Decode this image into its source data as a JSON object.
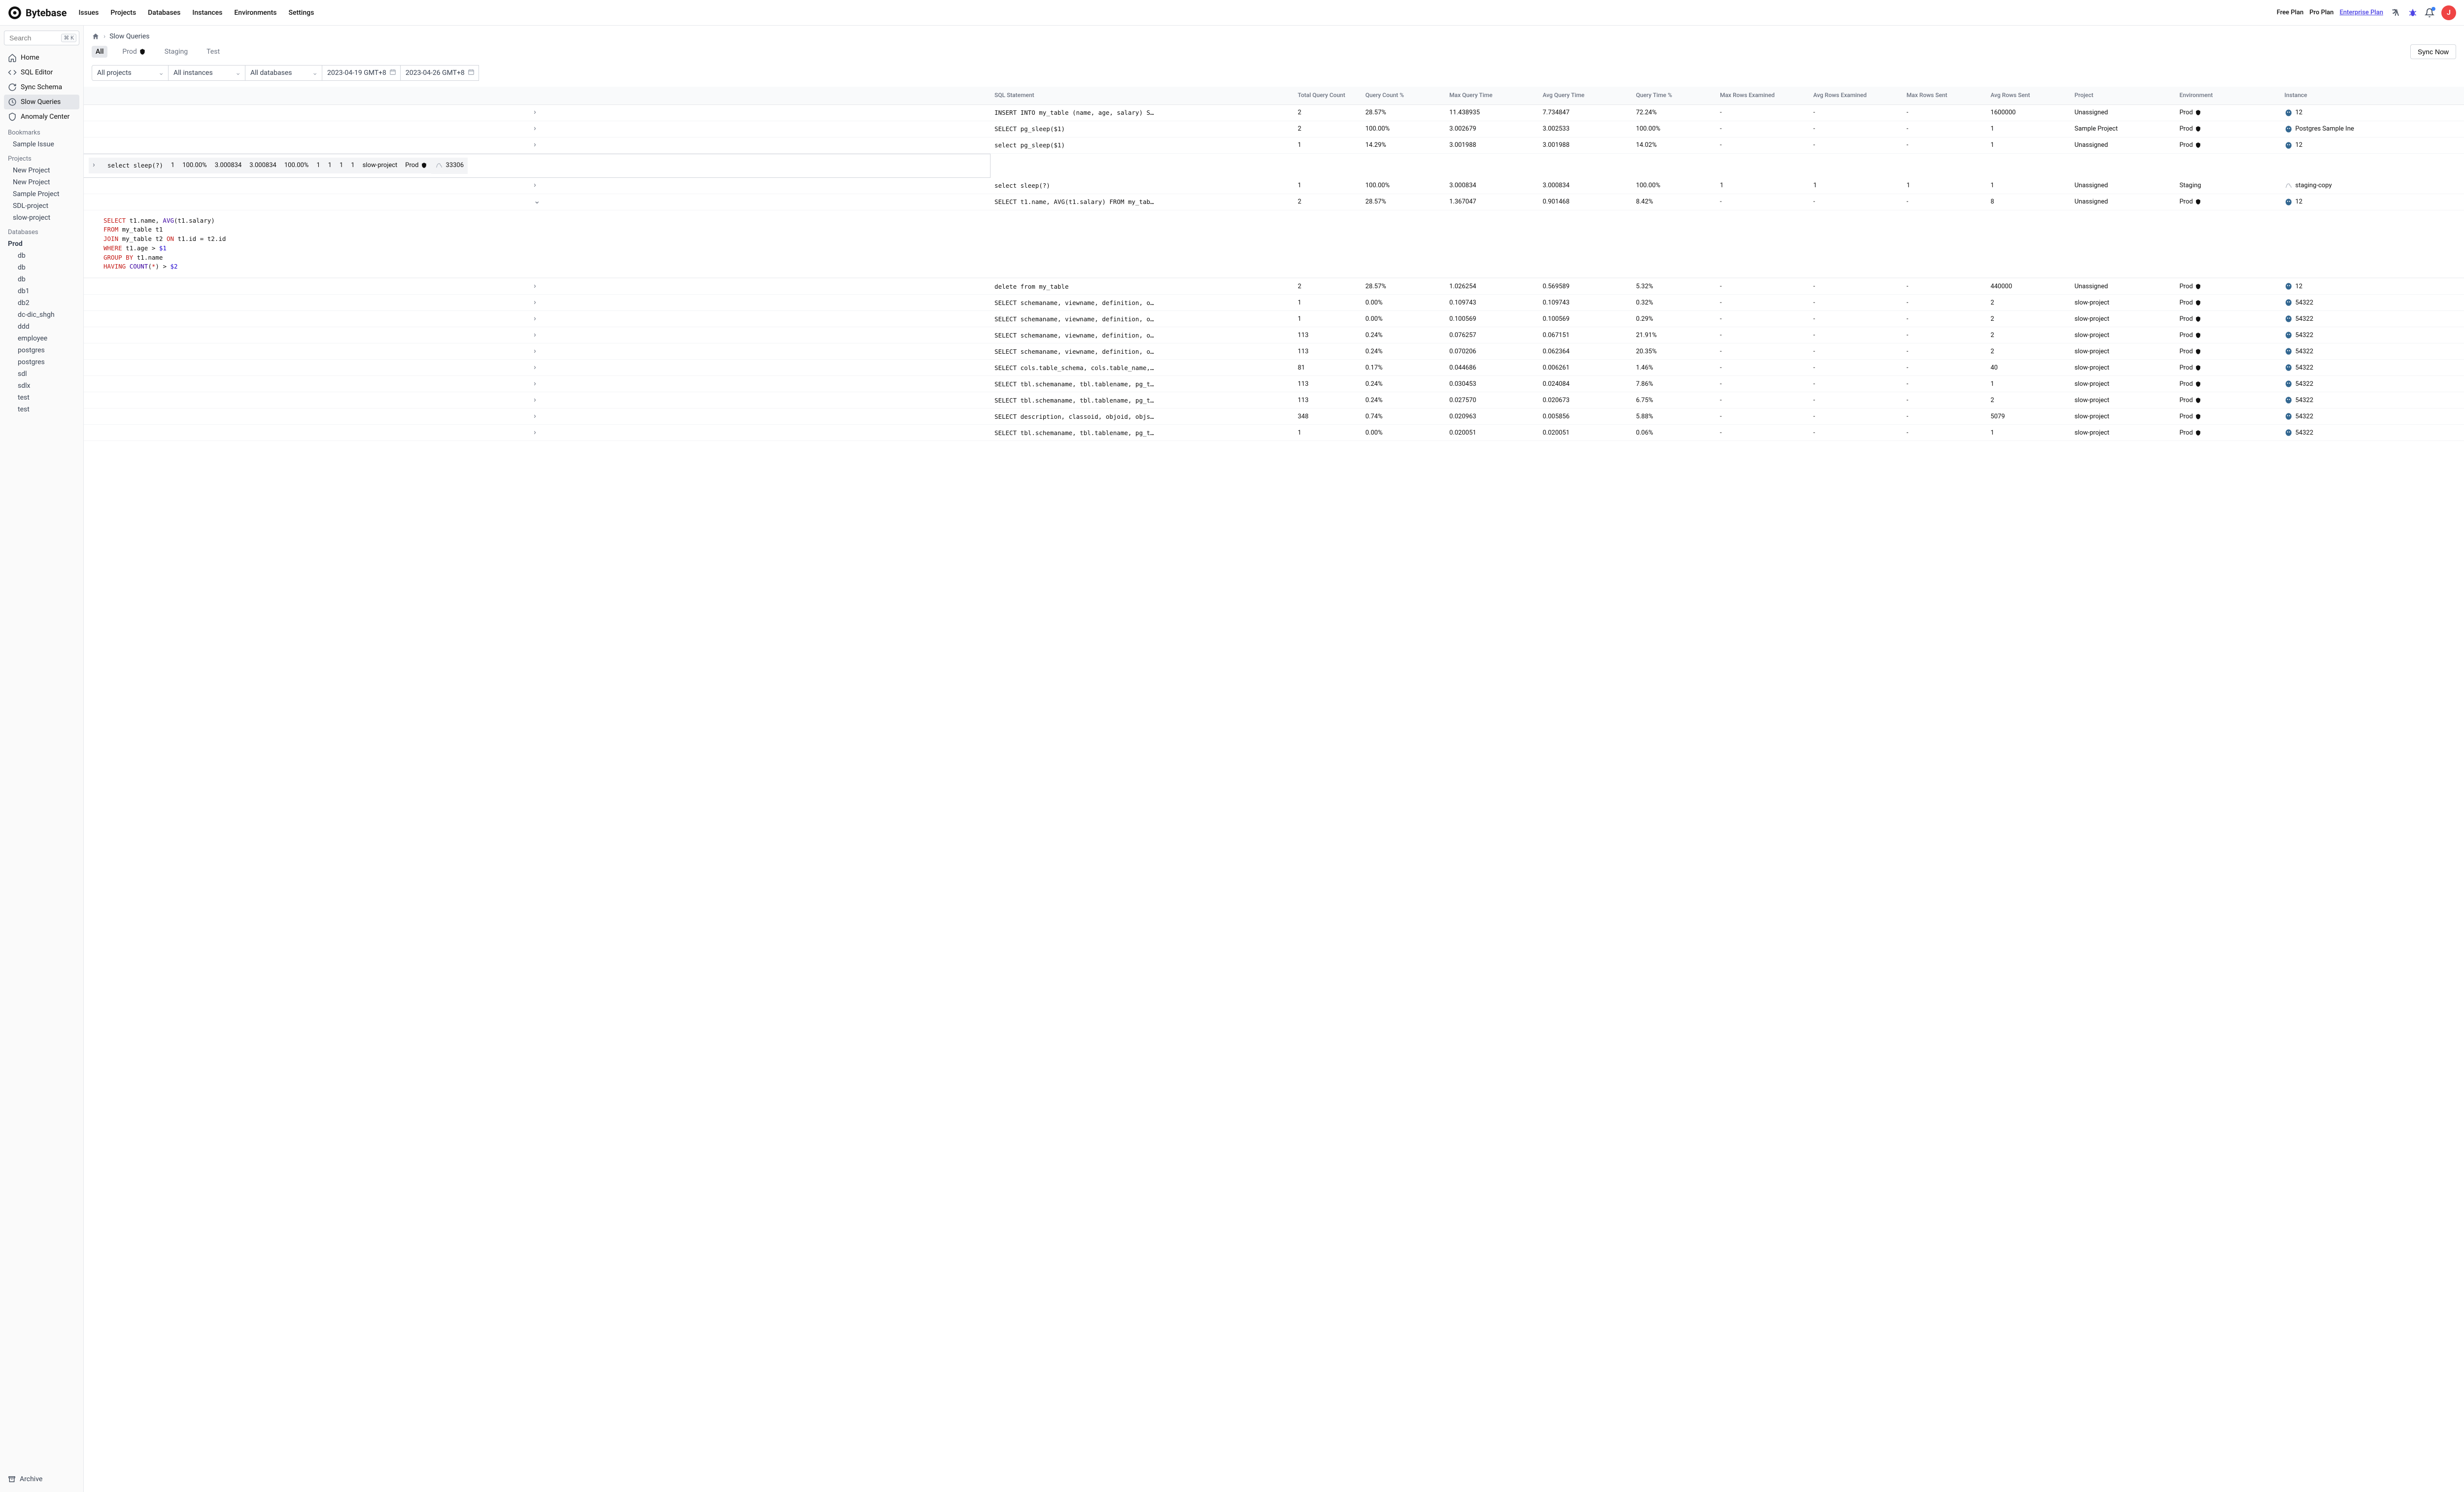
{
  "app_name": "Bytebase",
  "topnav": [
    "Issues",
    "Projects",
    "Databases",
    "Instances",
    "Environments",
    "Settings"
  ],
  "plans": {
    "free": "Free Plan",
    "pro": "Pro Plan",
    "ent": "Enterprise Plan"
  },
  "avatar_letter": "J",
  "search_placeholder": "Search",
  "search_kbd": "⌘ K",
  "side_nav": [
    {
      "label": "Home",
      "icon": "home"
    },
    {
      "label": "SQL Editor",
      "icon": "code"
    },
    {
      "label": "Sync Schema",
      "icon": "sync"
    },
    {
      "label": "Slow Queries",
      "icon": "clock",
      "active": true
    },
    {
      "label": "Anomaly Center",
      "icon": "shield"
    }
  ],
  "bookmarks_label": "Bookmarks",
  "bookmarks": [
    "Sample Issue"
  ],
  "projects_label": "Projects",
  "projects": [
    "New Project",
    "New Project",
    "Sample Project",
    "SDL-project",
    "slow-project"
  ],
  "databases_label": "Databases",
  "db_group": "Prod",
  "databases": [
    "db",
    "db",
    "db",
    "db1",
    "db2",
    "dc-dic_shgh",
    "ddd",
    "employee",
    "postgres",
    "postgres",
    "sdl",
    "sdlx",
    "test",
    "test"
  ],
  "archive_label": "Archive",
  "breadcrumb_page": "Slow Queries",
  "env_tabs": [
    "All",
    "Prod",
    "Staging",
    "Test"
  ],
  "sync_btn": "Sync Now",
  "filters": {
    "projects": "All projects",
    "instances": "All instances",
    "databases": "All databases",
    "date_from": "2023-04-19 GMT+8",
    "date_to": "2023-04-26 GMT+8"
  },
  "cols": [
    "SQL Statement",
    "Total Query Count",
    "Query Count %",
    "Max Query Time",
    "Avg Query Time",
    "Query Time %",
    "Max Rows Examined",
    "Avg Rows Examined",
    "Max Rows Sent",
    "Avg Rows Sent",
    "Project",
    "Environment",
    "Instance"
  ],
  "rows": [
    {
      "sql": "INSERT INTO my_table (name, age, salary) S…",
      "cnt": "2",
      "cntp": "28.57%",
      "maxt": "11.438935",
      "avgt": "7.734847",
      "tp": "72.24%",
      "mre": "-",
      "are": "-",
      "mrs": "-",
      "ars": "1600000",
      "proj": "Unassigned",
      "env": "Prod",
      "envShield": true,
      "inst": "12",
      "itype": "pg"
    },
    {
      "sql": "SELECT pg_sleep($1)",
      "cnt": "2",
      "cntp": "100.00%",
      "maxt": "3.002679",
      "avgt": "3.002533",
      "tp": "100.00%",
      "mre": "-",
      "are": "-",
      "mrs": "-",
      "ars": "1",
      "proj": "Sample Project",
      "env": "Prod",
      "envShield": true,
      "inst": "Postgres Sample Ine",
      "itype": "pg"
    },
    {
      "sql": "select pg_sleep($1)",
      "cnt": "1",
      "cntp": "14.29%",
      "maxt": "3.001988",
      "avgt": "3.001988",
      "tp": "14.02%",
      "mre": "-",
      "are": "-",
      "mrs": "-",
      "ars": "1",
      "proj": "Unassigned",
      "env": "Prod",
      "envShield": true,
      "inst": "12",
      "itype": "pg"
    },
    {
      "sql": "select sleep(?)",
      "cnt": "1",
      "cntp": "100.00%",
      "maxt": "3.000834",
      "avgt": "3.000834",
      "tp": "100.00%",
      "mre": "1",
      "are": "1",
      "mrs": "1",
      "ars": "1",
      "proj": "slow-project",
      "env": "Prod",
      "envShield": true,
      "inst": "33306",
      "itype": "my",
      "sel": true
    },
    {
      "sql": "select sleep(?)",
      "cnt": "1",
      "cntp": "100.00%",
      "maxt": "3.000834",
      "avgt": "3.000834",
      "tp": "100.00%",
      "mre": "1",
      "are": "1",
      "mrs": "1",
      "ars": "1",
      "proj": "Unassigned",
      "env": "Staging",
      "envShield": false,
      "inst": "staging-copy",
      "itype": "my"
    },
    {
      "sql": "SELECT t1.name, AVG(t1.salary) FROM my_tab…",
      "cnt": "2",
      "cntp": "28.57%",
      "maxt": "1.367047",
      "avgt": "0.901468",
      "tp": "8.42%",
      "mre": "-",
      "are": "-",
      "mrs": "-",
      "ars": "8",
      "proj": "Unassigned",
      "env": "Prod",
      "envShield": true,
      "inst": "12",
      "itype": "pg",
      "expanded": true
    },
    {
      "sql": "delete from my_table",
      "cnt": "2",
      "cntp": "28.57%",
      "maxt": "1.026254",
      "avgt": "0.569589",
      "tp": "5.32%",
      "mre": "-",
      "are": "-",
      "mrs": "-",
      "ars": "440000",
      "proj": "Unassigned",
      "env": "Prod",
      "envShield": true,
      "inst": "12",
      "itype": "pg"
    },
    {
      "sql": "SELECT schemaname, viewname, definition, o…",
      "cnt": "1",
      "cntp": "0.00%",
      "maxt": "0.109743",
      "avgt": "0.109743",
      "tp": "0.32%",
      "mre": "-",
      "are": "-",
      "mrs": "-",
      "ars": "2",
      "proj": "slow-project",
      "env": "Prod",
      "envShield": true,
      "inst": "54322",
      "itype": "pg"
    },
    {
      "sql": "SELECT schemaname, viewname, definition, o…",
      "cnt": "1",
      "cntp": "0.00%",
      "maxt": "0.100569",
      "avgt": "0.100569",
      "tp": "0.29%",
      "mre": "-",
      "are": "-",
      "mrs": "-",
      "ars": "2",
      "proj": "slow-project",
      "env": "Prod",
      "envShield": true,
      "inst": "54322",
      "itype": "pg"
    },
    {
      "sql": "SELECT schemaname, viewname, definition, o…",
      "cnt": "113",
      "cntp": "0.24%",
      "maxt": "0.076257",
      "avgt": "0.067151",
      "tp": "21.91%",
      "mre": "-",
      "are": "-",
      "mrs": "-",
      "ars": "2",
      "proj": "slow-project",
      "env": "Prod",
      "envShield": true,
      "inst": "54322",
      "itype": "pg"
    },
    {
      "sql": "SELECT schemaname, viewname, definition, o…",
      "cnt": "113",
      "cntp": "0.24%",
      "maxt": "0.070206",
      "avgt": "0.062364",
      "tp": "20.35%",
      "mre": "-",
      "are": "-",
      "mrs": "-",
      "ars": "2",
      "proj": "slow-project",
      "env": "Prod",
      "envShield": true,
      "inst": "54322",
      "itype": "pg"
    },
    {
      "sql": "SELECT cols.table_schema, cols.table_name,…",
      "cnt": "81",
      "cntp": "0.17%",
      "maxt": "0.044686",
      "avgt": "0.006261",
      "tp": "1.46%",
      "mre": "-",
      "are": "-",
      "mrs": "-",
      "ars": "40",
      "proj": "slow-project",
      "env": "Prod",
      "envShield": true,
      "inst": "54322",
      "itype": "pg"
    },
    {
      "sql": "SELECT tbl.schemaname, tbl.tablename, pg_t…",
      "cnt": "113",
      "cntp": "0.24%",
      "maxt": "0.030453",
      "avgt": "0.024084",
      "tp": "7.86%",
      "mre": "-",
      "are": "-",
      "mrs": "-",
      "ars": "1",
      "proj": "slow-project",
      "env": "Prod",
      "envShield": true,
      "inst": "54322",
      "itype": "pg"
    },
    {
      "sql": "SELECT tbl.schemaname, tbl.tablename, pg_t…",
      "cnt": "113",
      "cntp": "0.24%",
      "maxt": "0.027570",
      "avgt": "0.020673",
      "tp": "6.75%",
      "mre": "-",
      "are": "-",
      "mrs": "-",
      "ars": "2",
      "proj": "slow-project",
      "env": "Prod",
      "envShield": true,
      "inst": "54322",
      "itype": "pg"
    },
    {
      "sql": "SELECT description, classoid, objoid, objs…",
      "cnt": "348",
      "cntp": "0.74%",
      "maxt": "0.020963",
      "avgt": "0.005856",
      "tp": "5.88%",
      "mre": "-",
      "are": "-",
      "mrs": "-",
      "ars": "5079",
      "proj": "slow-project",
      "env": "Prod",
      "envShield": true,
      "inst": "54322",
      "itype": "pg"
    },
    {
      "sql": "SELECT tbl.schemaname, tbl.tablename, pg_t…",
      "cnt": "1",
      "cntp": "0.00%",
      "maxt": "0.020051",
      "avgt": "0.020051",
      "tp": "0.06%",
      "mre": "-",
      "are": "-",
      "mrs": "-",
      "ars": "1",
      "proj": "slow-project",
      "env": "Prod",
      "envShield": true,
      "inst": "54322",
      "itype": "pg"
    }
  ],
  "expanded_sql_lines": [
    [
      {
        "t": "SELECT",
        "c": "kw"
      },
      {
        "t": " t1.name, "
      },
      {
        "t": "AVG",
        "c": "fn"
      },
      {
        "t": "(t1.salary)"
      }
    ],
    [
      {
        "t": "FROM",
        "c": "kw"
      },
      {
        "t": " my_table t1"
      }
    ],
    [
      {
        "t": "JOIN",
        "c": "kw"
      },
      {
        "t": " my_table t2 "
      },
      {
        "t": "ON",
        "c": "kw"
      },
      {
        "t": " t1.id = t2.id"
      }
    ],
    [
      {
        "t": "WHERE",
        "c": "kw"
      },
      {
        "t": " t1.age > "
      },
      {
        "t": "$1",
        "c": "num"
      }
    ],
    [
      {
        "t": "GROUP BY",
        "c": "kw"
      },
      {
        "t": " t1.name"
      }
    ],
    [
      {
        "t": "HAVING",
        "c": "kw"
      },
      {
        "t": " "
      },
      {
        "t": "COUNT",
        "c": "fn"
      },
      {
        "t": "("
      },
      {
        "t": "*",
        "c": "star"
      },
      {
        "t": ") > "
      },
      {
        "t": "$2",
        "c": "num"
      }
    ]
  ]
}
